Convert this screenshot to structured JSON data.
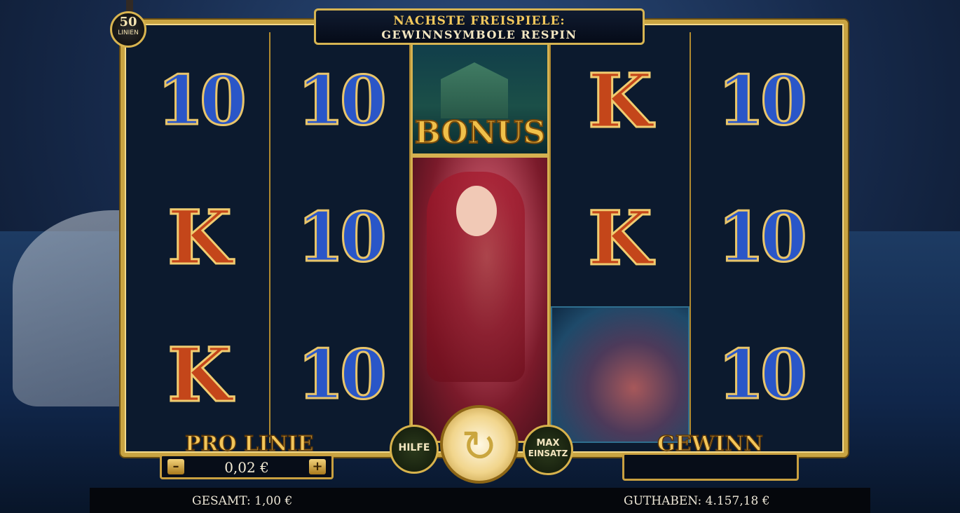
{
  "lines": {
    "count": "50",
    "label": "LINIEN"
  },
  "banner": {
    "line1": "NACHSTE FREISPIELE:",
    "line2": "GEWINNSYMBOLE RESPIN"
  },
  "reels": [
    [
      "10",
      "K",
      "K"
    ],
    [
      "10",
      "10",
      "10"
    ],
    [
      "BONUS",
      "mermaid"
    ],
    [
      "K",
      "K",
      "kraken"
    ],
    [
      "10",
      "10",
      "10"
    ]
  ],
  "bonus_label": "BONUS",
  "controls": {
    "pro_linie_label": "PRO LINIE",
    "bet_value": "0,02 €",
    "minus": "–",
    "plus": "+",
    "help": "HILFE",
    "max_line1": "MAX",
    "max_line2": "EINSATZ",
    "gewinn_label": "GEWINN",
    "spin_icon": "spin-icon"
  },
  "status": {
    "total": "GESAMT: 1,00 €",
    "balance": "GUTHABEN: 4.157,18 €"
  }
}
